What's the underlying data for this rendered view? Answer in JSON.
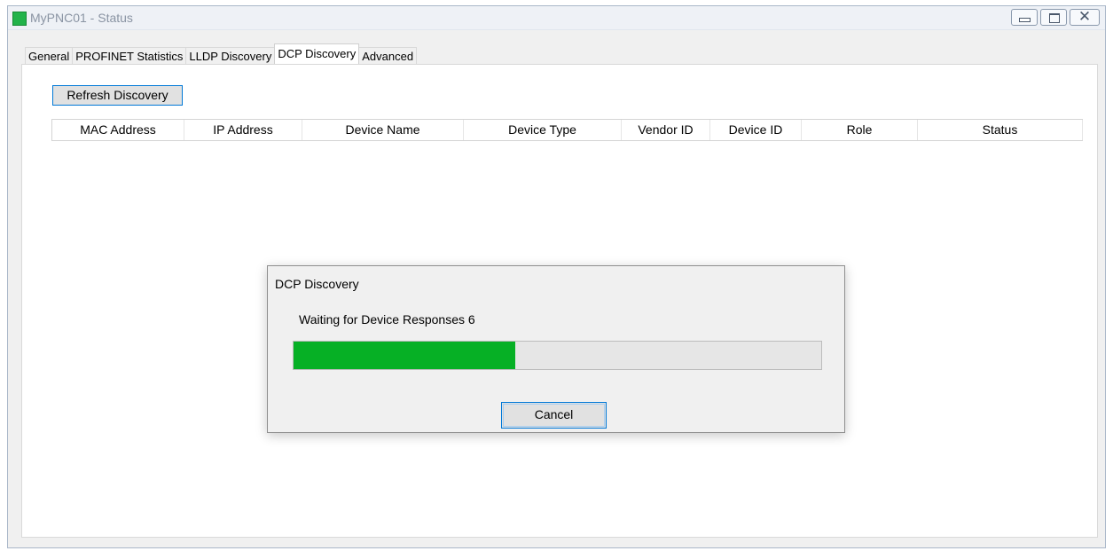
{
  "window": {
    "title": "MyPNC01 - Status",
    "icon": "app-status-icon",
    "controls": {
      "minimize": "minimize-icon",
      "maximize": "maximize-icon",
      "close": "close-icon"
    }
  },
  "tabs": [
    {
      "label": "General",
      "active": false
    },
    {
      "label": "PROFINET Statistics",
      "active": false
    },
    {
      "label": "LLDP Discovery",
      "active": false
    },
    {
      "label": "DCP Discovery",
      "active": true
    },
    {
      "label": "Advanced",
      "active": false
    }
  ],
  "dcp": {
    "refresh_label": "Refresh Discovery",
    "columns": [
      "MAC Address",
      "IP Address",
      "Device Name",
      "Device Type",
      "Vendor ID",
      "Device ID",
      "Role",
      "Status"
    ],
    "rows": []
  },
  "dialog": {
    "title": "DCP Discovery",
    "message": "Waiting for Device Responses 6",
    "progress": 0.42,
    "cancel_label": "Cancel"
  },
  "colors": {
    "app_icon": "#22b34a",
    "progress_fill": "#06b025",
    "focus_border": "#0078d7"
  }
}
